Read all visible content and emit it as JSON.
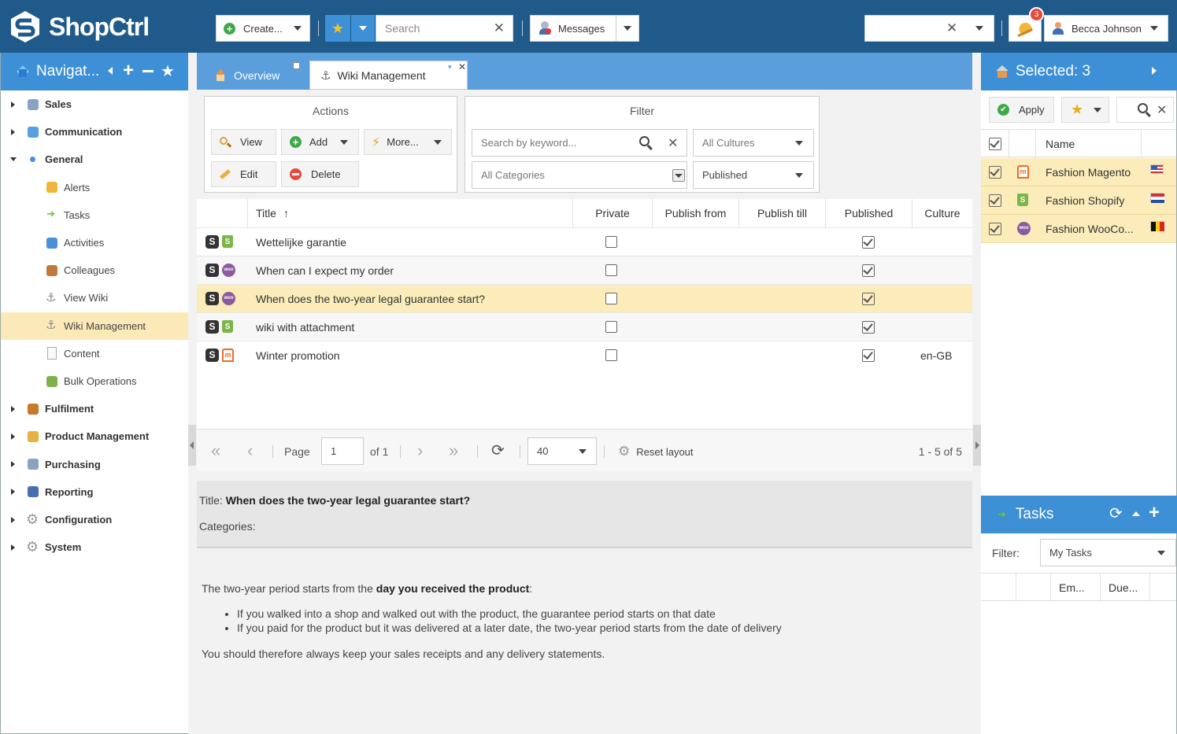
{
  "app": {
    "brand": "ShopCtrl"
  },
  "topbar": {
    "create_label": "Create...",
    "search_placeholder": "Search",
    "messages_label": "Messages",
    "notification_count": "3",
    "user_name": "Becca Johnson"
  },
  "navigation": {
    "title": "Navigat...",
    "items": [
      {
        "label": "Sales",
        "level": "top",
        "expanded": false
      },
      {
        "label": "Communication",
        "level": "top",
        "expanded": false
      },
      {
        "label": "General",
        "level": "top",
        "expanded": true
      },
      {
        "label": "Alerts",
        "level": "sub"
      },
      {
        "label": "Tasks",
        "level": "sub"
      },
      {
        "label": "Activities",
        "level": "sub"
      },
      {
        "label": "Colleagues",
        "level": "sub"
      },
      {
        "label": "View Wiki",
        "level": "sub"
      },
      {
        "label": "Wiki Management",
        "level": "sub",
        "selected": true
      },
      {
        "label": "Content",
        "level": "sub"
      },
      {
        "label": "Bulk Operations",
        "level": "sub"
      },
      {
        "label": "Fulfilment",
        "level": "top",
        "expanded": false
      },
      {
        "label": "Product Management",
        "level": "top",
        "expanded": false
      },
      {
        "label": "Purchasing",
        "level": "top",
        "expanded": false
      },
      {
        "label": "Reporting",
        "level": "top",
        "expanded": false
      },
      {
        "label": "Configuration",
        "level": "top",
        "expanded": false
      },
      {
        "label": "System",
        "level": "top",
        "expanded": false
      }
    ]
  },
  "tabs": [
    {
      "label": "Overview",
      "active": false
    },
    {
      "label": "Wiki Management",
      "active": true
    }
  ],
  "actions": {
    "title": "Actions",
    "view": "View",
    "add": "Add",
    "more": "More...",
    "edit": "Edit",
    "delete": "Delete"
  },
  "filter": {
    "title": "Filter",
    "keyword_placeholder": "Search by keyword...",
    "cultures": "All Cultures",
    "categories": "All Categories",
    "published": "Published"
  },
  "grid": {
    "columns": [
      "Title",
      "Private",
      "Publish from",
      "Publish till",
      "Published",
      "Culture"
    ],
    "rows": [
      {
        "title": "Wettelijke garantie",
        "store": "shopify",
        "private": false,
        "published": true,
        "culture": ""
      },
      {
        "title": "When can I expect my order",
        "store": "woo",
        "private": false,
        "published": true,
        "culture": ""
      },
      {
        "title": "When does the two-year legal guarantee start?",
        "store": "woo",
        "private": false,
        "published": true,
        "culture": "",
        "selected": true
      },
      {
        "title": "wiki with attachment",
        "store": "shopify",
        "private": false,
        "published": true,
        "culture": ""
      },
      {
        "title": "Winter promotion",
        "store": "magento",
        "private": false,
        "published": true,
        "culture": "en-GB"
      }
    ]
  },
  "pager": {
    "page_label": "Page",
    "page_value": "1",
    "of_label": "of 1",
    "page_size": "40",
    "reset_label": "Reset layout",
    "summary": "1 - 5 of 5"
  },
  "detail": {
    "title_label": "Title:",
    "title_value": "When does the two-year legal guarantee start?",
    "categories_label": "Categories:",
    "body_intro": "The two-year period starts from the ",
    "body_intro_bold": "day you received the product",
    "body_intro_end": ":",
    "bullets": [
      "If you walked into a shop and walked out with the product, the guarantee period starts on that date",
      "If you paid for the product but it was delivered at a later date, the two-year period starts from the date of delivery"
    ],
    "body_outro": "You should therefore always keep your sales receipts and any delivery statements."
  },
  "selected": {
    "title": "Selected: 3",
    "apply": "Apply",
    "name_header": "Name",
    "items": [
      {
        "name": "Fashion Magento",
        "store": "magento",
        "flag": "us"
      },
      {
        "name": "Fashion Shopify",
        "store": "shopify",
        "flag": "nl"
      },
      {
        "name": "Fashion WooCo...",
        "store": "woo",
        "flag": "be"
      }
    ]
  },
  "tasks": {
    "title": "Tasks",
    "filter_label": "Filter:",
    "filter_value": "My Tasks",
    "col_em": "Em...",
    "col_due": "Due..."
  },
  "colors": {
    "topbar": "#1f5a8a",
    "panel_header": "#3d8fd6",
    "selection": "#fbecba"
  }
}
